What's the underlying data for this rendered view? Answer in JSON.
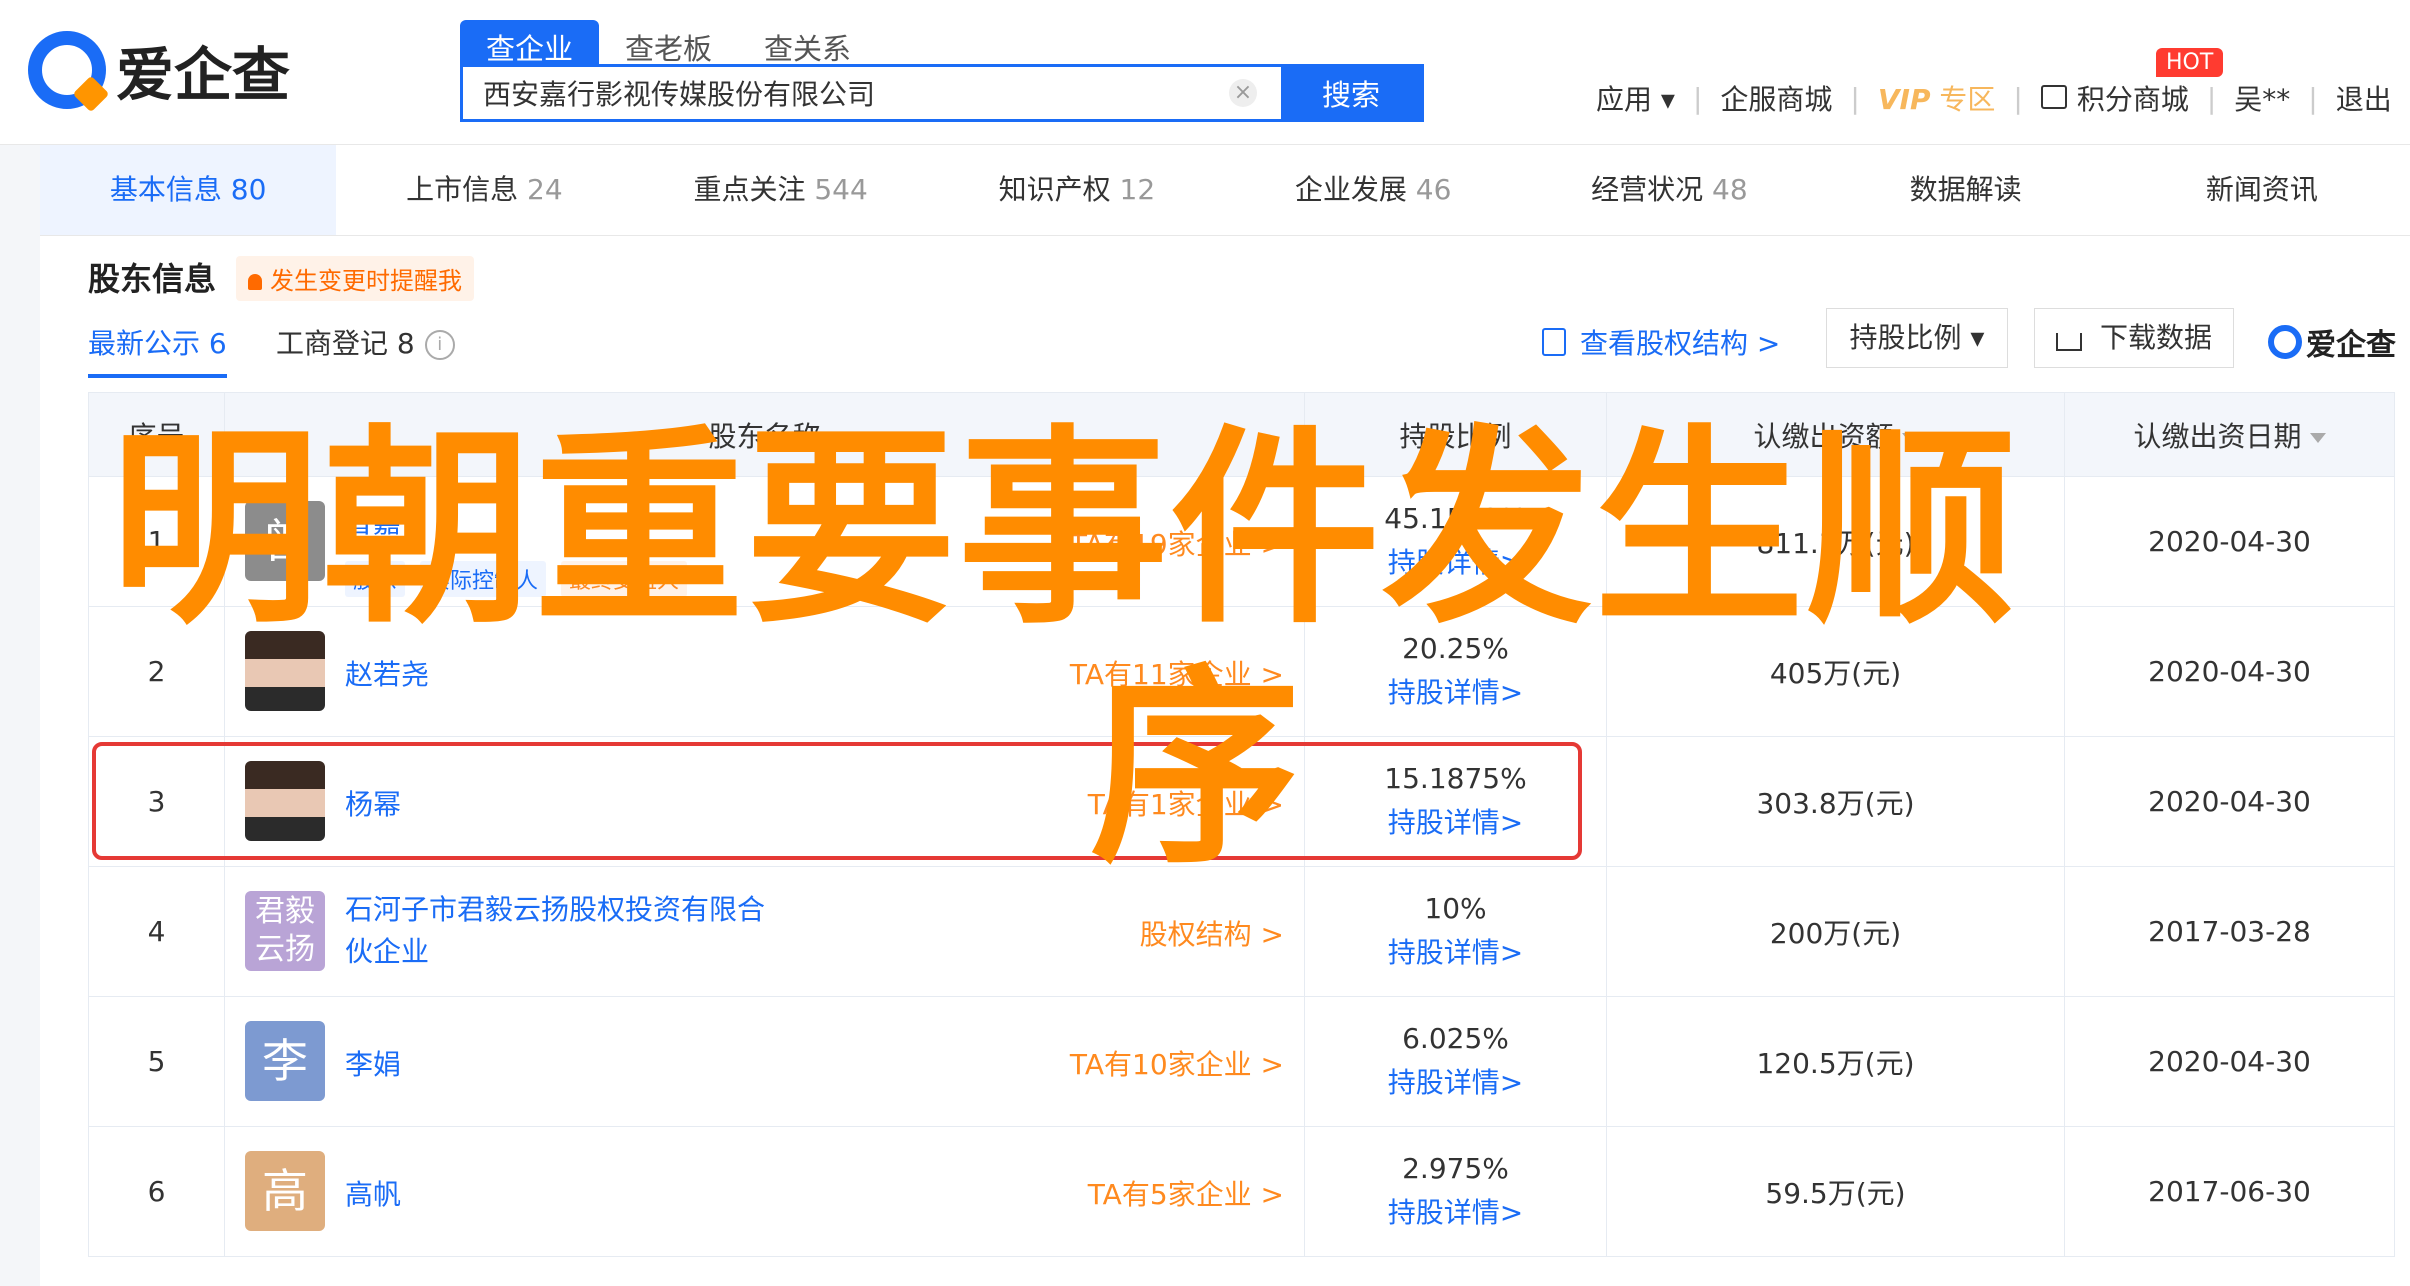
{
  "brand": {
    "name": "爱企查"
  },
  "search": {
    "tabs": [
      "查企业",
      "查老板",
      "查关系"
    ],
    "query": "西安嘉行影视传媒股份有限公司",
    "clear": "×",
    "button": "搜索"
  },
  "topnav": {
    "apps": "应用 ▾",
    "mall": "企服商城",
    "vip": "VIP",
    "vip_zone": "专区",
    "points": "积分商城",
    "hot": "HOT",
    "user": "吴**",
    "logout": "退出"
  },
  "main_tabs": [
    {
      "label": "基本信息",
      "count": "80"
    },
    {
      "label": "上市信息",
      "count": "24"
    },
    {
      "label": "重点关注",
      "count": "544"
    },
    {
      "label": "知识产权",
      "count": "12"
    },
    {
      "label": "企业发展",
      "count": "46"
    },
    {
      "label": "经营状况",
      "count": "48"
    },
    {
      "label": "数据解读",
      "count": ""
    },
    {
      "label": "新闻资讯",
      "count": ""
    }
  ],
  "section": {
    "title": "股东信息",
    "remind": "发生变更时提醒我",
    "sub_tabs": [
      {
        "label": "最新公示",
        "count": "6"
      },
      {
        "label": "工商登记",
        "count": "8"
      }
    ],
    "info": "i",
    "equity_link": "查看股权结构 >",
    "ratio_select": "持股比例 ▾",
    "download": "下载数据"
  },
  "table": {
    "headers": [
      "序号",
      "股东名称",
      "持股比例",
      "认缴出资额",
      "认缴出资日期"
    ],
    "detail_label": "持股详情>",
    "rows": [
      {
        "no": "1",
        "avatar": "曾",
        "name": "曾嘉",
        "tags": [
          "股东",
          "实际控制人",
          "最终受益人"
        ],
        "ta": "TA有19家企业 >",
        "pct": "45.1562%",
        "amount": "811.3万(元)",
        "date": "2020-04-30"
      },
      {
        "no": "2",
        "avatar": "",
        "name": "赵若尧",
        "tags": [],
        "ta": "TA有11家企业 >",
        "pct": "20.25%",
        "amount": "405万(元)",
        "date": "2020-04-30"
      },
      {
        "no": "3",
        "avatar": "",
        "name": "杨幂",
        "tags": [],
        "ta": "TA有1家企业 >",
        "pct": "15.1875%",
        "amount": "303.8万(元)",
        "date": "2020-04-30"
      },
      {
        "no": "4",
        "avatar": "君毅\n云扬",
        "name": "石河子市君毅云扬股权投资有限合伙企业",
        "tags": [],
        "ta": "股权结构 >",
        "pct": "10%",
        "amount": "200万(元)",
        "date": "2017-03-28"
      },
      {
        "no": "5",
        "avatar": "李",
        "name": "李娟",
        "tags": [],
        "ta": "TA有10家企业 >",
        "pct": "6.025%",
        "amount": "120.5万(元)",
        "date": "2020-04-30"
      },
      {
        "no": "6",
        "avatar": "高",
        "name": "高帆",
        "tags": [],
        "ta": "TA有5家企业 >",
        "pct": "2.975%",
        "amount": "59.5万(元)",
        "date": "2017-06-30"
      }
    ]
  },
  "overlay": {
    "line1": "明朝重要事件发生顺",
    "line2": "序"
  },
  "colors": {
    "accent": "#1a6cf6",
    "orange": "#ff8a1f",
    "highlight": "#e53935",
    "overlay": "#ff8c00"
  }
}
